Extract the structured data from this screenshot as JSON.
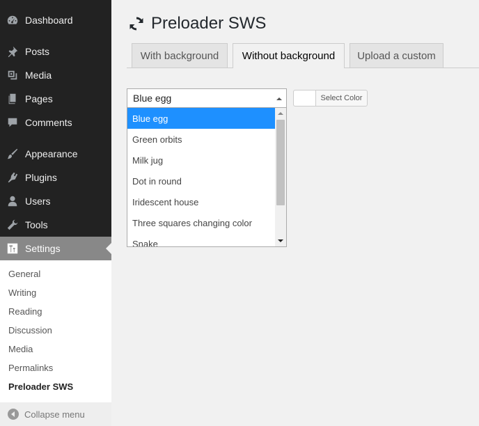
{
  "sidebar": {
    "items": [
      {
        "label": "Dashboard",
        "icon": "dashboard-icon"
      },
      {
        "label": "Posts",
        "icon": "pin-icon"
      },
      {
        "label": "Media",
        "icon": "media-icon"
      },
      {
        "label": "Pages",
        "icon": "pages-icon"
      },
      {
        "label": "Comments",
        "icon": "comment-icon"
      },
      {
        "label": "Appearance",
        "icon": "brush-icon"
      },
      {
        "label": "Plugins",
        "icon": "plugin-icon"
      },
      {
        "label": "Users",
        "icon": "user-icon"
      },
      {
        "label": "Tools",
        "icon": "wrench-icon"
      },
      {
        "label": "Settings",
        "icon": "settings-icon"
      }
    ],
    "submenu": [
      "General",
      "Writing",
      "Reading",
      "Discussion",
      "Media",
      "Permalinks",
      "Preloader SWS"
    ],
    "collapse_label": "Collapse menu"
  },
  "page": {
    "title": "Preloader SWS",
    "title_icon": "refresh-icon"
  },
  "tabs": [
    "With background",
    "Without background",
    "Upload a custom"
  ],
  "select": {
    "value": "Blue egg",
    "options": [
      "Blue egg",
      "Green orbits",
      "Milk jug",
      "Dot in round",
      "Iridescent house",
      "Three squares changing color",
      "Snake"
    ]
  },
  "color_button": {
    "label": "Select Color"
  },
  "colors": {
    "sidebar": "#222222",
    "current_menu": "#888888",
    "option_selected": "#1e90ff"
  }
}
